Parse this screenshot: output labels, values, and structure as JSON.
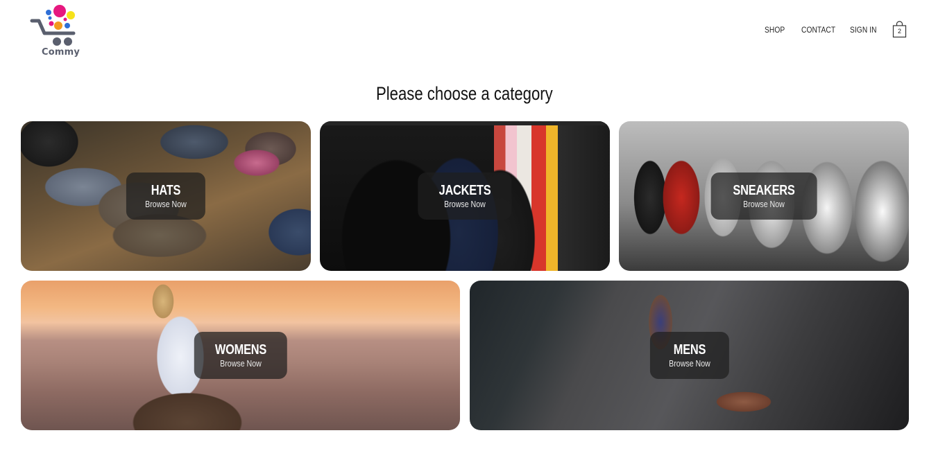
{
  "brand": {
    "name": "Commy"
  },
  "nav": {
    "items": [
      {
        "label": "SHOP"
      },
      {
        "label": "CONTACT"
      },
      {
        "label": "SIGN IN"
      }
    ],
    "cart_count": "2"
  },
  "page": {
    "title": "Please choose a category"
  },
  "categories": [
    {
      "name": "HATS",
      "cta": "Browse Now"
    },
    {
      "name": "JACKETS",
      "cta": "Browse Now"
    },
    {
      "name": "SNEAKERS",
      "cta": "Browse Now"
    },
    {
      "name": "WOMENS",
      "cta": "Browse Now"
    },
    {
      "name": "MENS",
      "cta": "Browse Now"
    }
  ],
  "colors": {
    "logo_pink": "#e6187f",
    "logo_yellow": "#f6e21a",
    "logo_blue": "#2f6fd6",
    "logo_orange": "#f39a1d",
    "logo_gray": "#5a5f6e",
    "caption_bg": "#1e1e1e"
  },
  "icons": [
    "shopping-cart-logo-icon",
    "shopping-bag-icon"
  ]
}
